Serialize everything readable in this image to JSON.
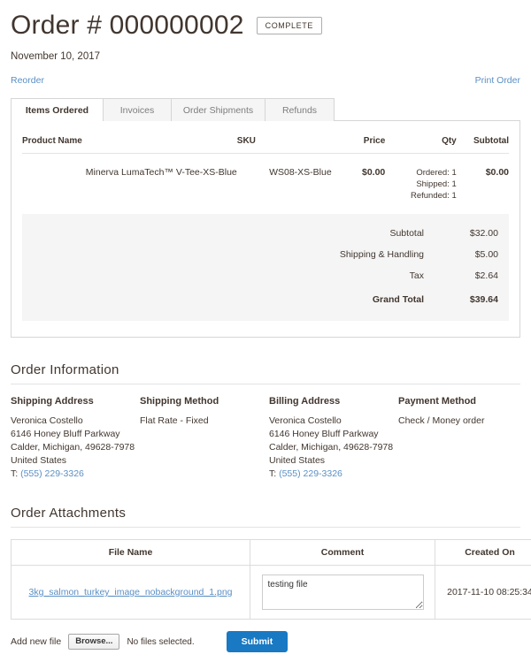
{
  "header": {
    "title": "Order # 000000002",
    "status": "COMPLETE",
    "date": "November 10, 2017"
  },
  "actions": {
    "reorder": "Reorder",
    "print_order": "Print Order"
  },
  "tabs": [
    {
      "label": "Items Ordered",
      "active": true
    },
    {
      "label": "Invoices",
      "active": false
    },
    {
      "label": "Order Shipments",
      "active": false
    },
    {
      "label": "Refunds",
      "active": false
    }
  ],
  "items_table": {
    "columns": [
      "Product Name",
      "SKU",
      "Price",
      "Qty",
      "Subtotal"
    ],
    "rows": [
      {
        "product_name": "Minerva LumaTech™ V-Tee-XS-Blue",
        "sku": "WS08-XS-Blue",
        "price": "$0.00",
        "qty_ordered": "Ordered: 1",
        "qty_shipped": "Shipped: 1",
        "qty_refunded": "Refunded: 1",
        "subtotal": "$0.00"
      }
    ],
    "totals": [
      {
        "label": "Subtotal",
        "value": "$32.00"
      },
      {
        "label": "Shipping & Handling",
        "value": "$5.00"
      },
      {
        "label": "Tax",
        "value": "$2.64"
      }
    ],
    "grand_total": {
      "label": "Grand Total",
      "value": "$39.64"
    }
  },
  "order_information": {
    "heading": "Order Information",
    "shipping_address": {
      "title": "Shipping Address",
      "name": "Veronica Costello",
      "street": "6146 Honey Bluff Parkway",
      "city_state_zip": "Calder, Michigan, 49628-7978",
      "country": "United States",
      "phone_prefix": "T: ",
      "phone": "(555) 229-3326"
    },
    "shipping_method": {
      "title": "Shipping Method",
      "value": "Flat Rate - Fixed"
    },
    "billing_address": {
      "title": "Billing Address",
      "name": "Veronica Costello",
      "street": "6146 Honey Bluff Parkway",
      "city_state_zip": "Calder, Michigan, 49628-7978",
      "country": "United States",
      "phone_prefix": "T: ",
      "phone": "(555) 229-3326"
    },
    "payment_method": {
      "title": "Payment Method",
      "value": "Check / Money order"
    }
  },
  "attachments": {
    "heading": "Order Attachments",
    "columns": [
      "File Name",
      "Comment",
      "Created On"
    ],
    "rows": [
      {
        "file_name": "3kg_salmon_turkey_image_nobackground_1.png",
        "comment": "testing file",
        "created_on": "2017-11-10 08:25:34"
      }
    ],
    "upload": {
      "label": "Add new file",
      "browse_label": "Browse...",
      "no_files_text": "No files selected.",
      "submit_label": "Submit"
    }
  },
  "colors": {
    "link": "#5a8fc4",
    "submit": "#1979c3",
    "text": "#41362f",
    "border": "#d6d6d6"
  }
}
